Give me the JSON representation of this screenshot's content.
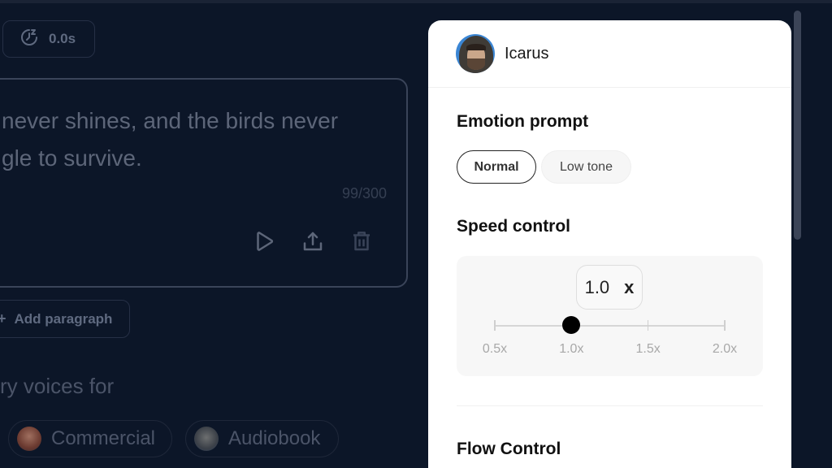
{
  "left": {
    "duration": {
      "icon": "timer-icon",
      "value": "0.0s"
    },
    "editor": {
      "text_lines": [
        "never shines, and the birds never",
        "gle to survive."
      ],
      "char_count": "99/300",
      "actions": [
        {
          "name": "play",
          "icon": "play-icon"
        },
        {
          "name": "share",
          "icon": "upload-icon"
        },
        {
          "name": "delete",
          "icon": "trash-icon"
        }
      ]
    },
    "add_paragraph": {
      "icon": "plus-icon",
      "label": "Add paragraph"
    },
    "voices_heading": "ry voices for",
    "voice_chips": [
      {
        "label": "Commercial"
      },
      {
        "label": "Audiobook"
      }
    ]
  },
  "panel": {
    "voice": {
      "name": "Icarus"
    },
    "emotion": {
      "title": "Emotion prompt",
      "options": [
        {
          "label": "Normal",
          "selected": true
        },
        {
          "label": "Low tone",
          "selected": false
        }
      ]
    },
    "speed": {
      "title": "Speed control",
      "value": "1.0",
      "unit": "x",
      "min": 0.5,
      "max": 2.0,
      "current": 1.0,
      "ticks": [
        "0.5x",
        "1.0x",
        "1.5x",
        "2.0x"
      ],
      "tick_values": [
        0.5,
        1.0,
        1.5,
        2.0
      ]
    },
    "flow": {
      "title": "Flow Control"
    }
  },
  "colors": {
    "background": "#0c1628",
    "panel": "#ffffff",
    "slider_thumb": "#000000"
  }
}
